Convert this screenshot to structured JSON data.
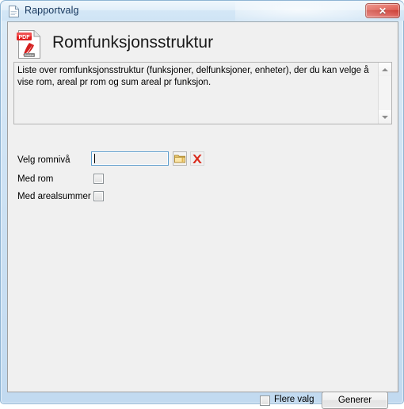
{
  "window": {
    "title": "Rapportvalg",
    "title_icon": "document-icon",
    "close_label": "✕",
    "frame_color": "#cfe4f5",
    "client_bg": "#f0f0f0"
  },
  "header": {
    "icon": "pdf-adobe-icon",
    "icon_badge": "PDF",
    "icon_brand": "Adobe",
    "heading": "Romfunksjonsstruktur"
  },
  "description": {
    "text": "Liste over romfunksjonsstruktur (funksjoner, delfunksjoner, enheter), der du kan velge å vise rom, areal pr rom og sum areal pr funksjon.",
    "scroll_up": "▲",
    "scroll_down": "▼"
  },
  "form": {
    "romniva_label": "Velg romnivå",
    "romniva_value": "",
    "romniva_placeholder": "",
    "browse_icon": "folder-icon",
    "clear_icon": "red-x-icon",
    "med_rom_label": "Med rom",
    "med_rom_checked": false,
    "med_arealsummer_label": "Med arealsummer",
    "med_arealsummer_checked": false
  },
  "footer": {
    "flere_valg_label": "Flere valg",
    "flere_valg_checked": false,
    "generer_label": "Generer"
  }
}
